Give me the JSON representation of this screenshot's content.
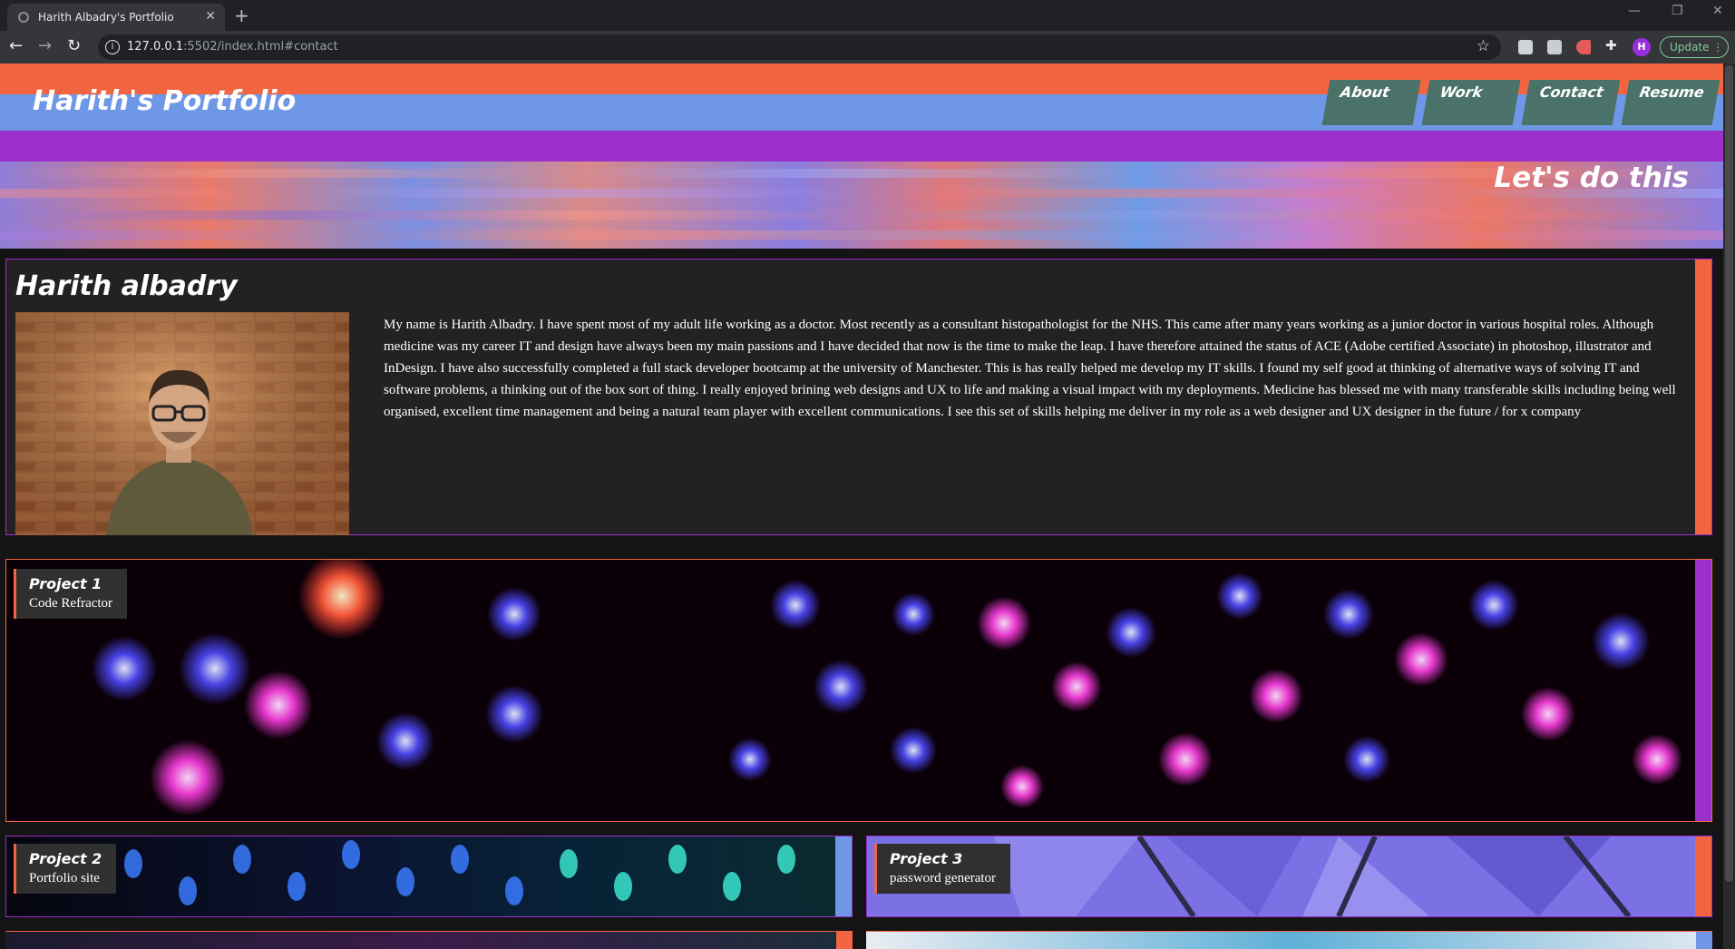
{
  "browser": {
    "tab_title": "Harith Albadry's Portfolio",
    "tab_close": "✕",
    "new_tab": "+",
    "url_host": "127.0.0.1",
    "url_rest": ":5502/index.html#contact",
    "profile_initial": "H",
    "update_label": "Update",
    "window_controls": [
      "—",
      "❐",
      "✕"
    ]
  },
  "header": {
    "title": "Harith's Portfolio",
    "nav": [
      "About",
      "Work",
      "Contact",
      "Resume"
    ]
  },
  "hero": {
    "text": "Let's do this"
  },
  "about": {
    "name": "Harith albadry",
    "bio": "My name is Harith Albadry. I have spent most of my adult life working as a doctor. Most recently as a consultant histopathologist for the NHS. This came after many years working as a junior doctor in various hospital roles. Although medicine was my career IT and design have always been my main passions and I have decided that now is the time to make the leap. I have therefore attained the status of ACE (Adobe certified Associate) in photoshop, illustrator and InDesign. I have also successfully completed a full stack developer bootcamp at the university of Manchester. This is has really helped me develop my IT skills. I found my self good at thinking of alternative ways of solving IT and software problems, a thinking out of the box sort of thing. I really enjoyed brining web designs and UX to life and making a visual impact with my deployments. Medicine has blessed me with many transferable skills including being well organised, excellent time management and being a natural team player with excellent communications. I see this set of skills helping me deliver in my role as a web designer and UX designer in the future / for x company"
  },
  "projects": [
    {
      "title": "Project 1",
      "subtitle": "Code Refractor"
    },
    {
      "title": "Project 2",
      "subtitle": "Portfolio site"
    },
    {
      "title": "Project 3",
      "subtitle": "password generator"
    }
  ],
  "colors": {
    "accent_orange": "#f26540",
    "accent_blue": "#6e97e7",
    "accent_purple": "#9b2fcc",
    "nav_green": "#4a7269"
  }
}
